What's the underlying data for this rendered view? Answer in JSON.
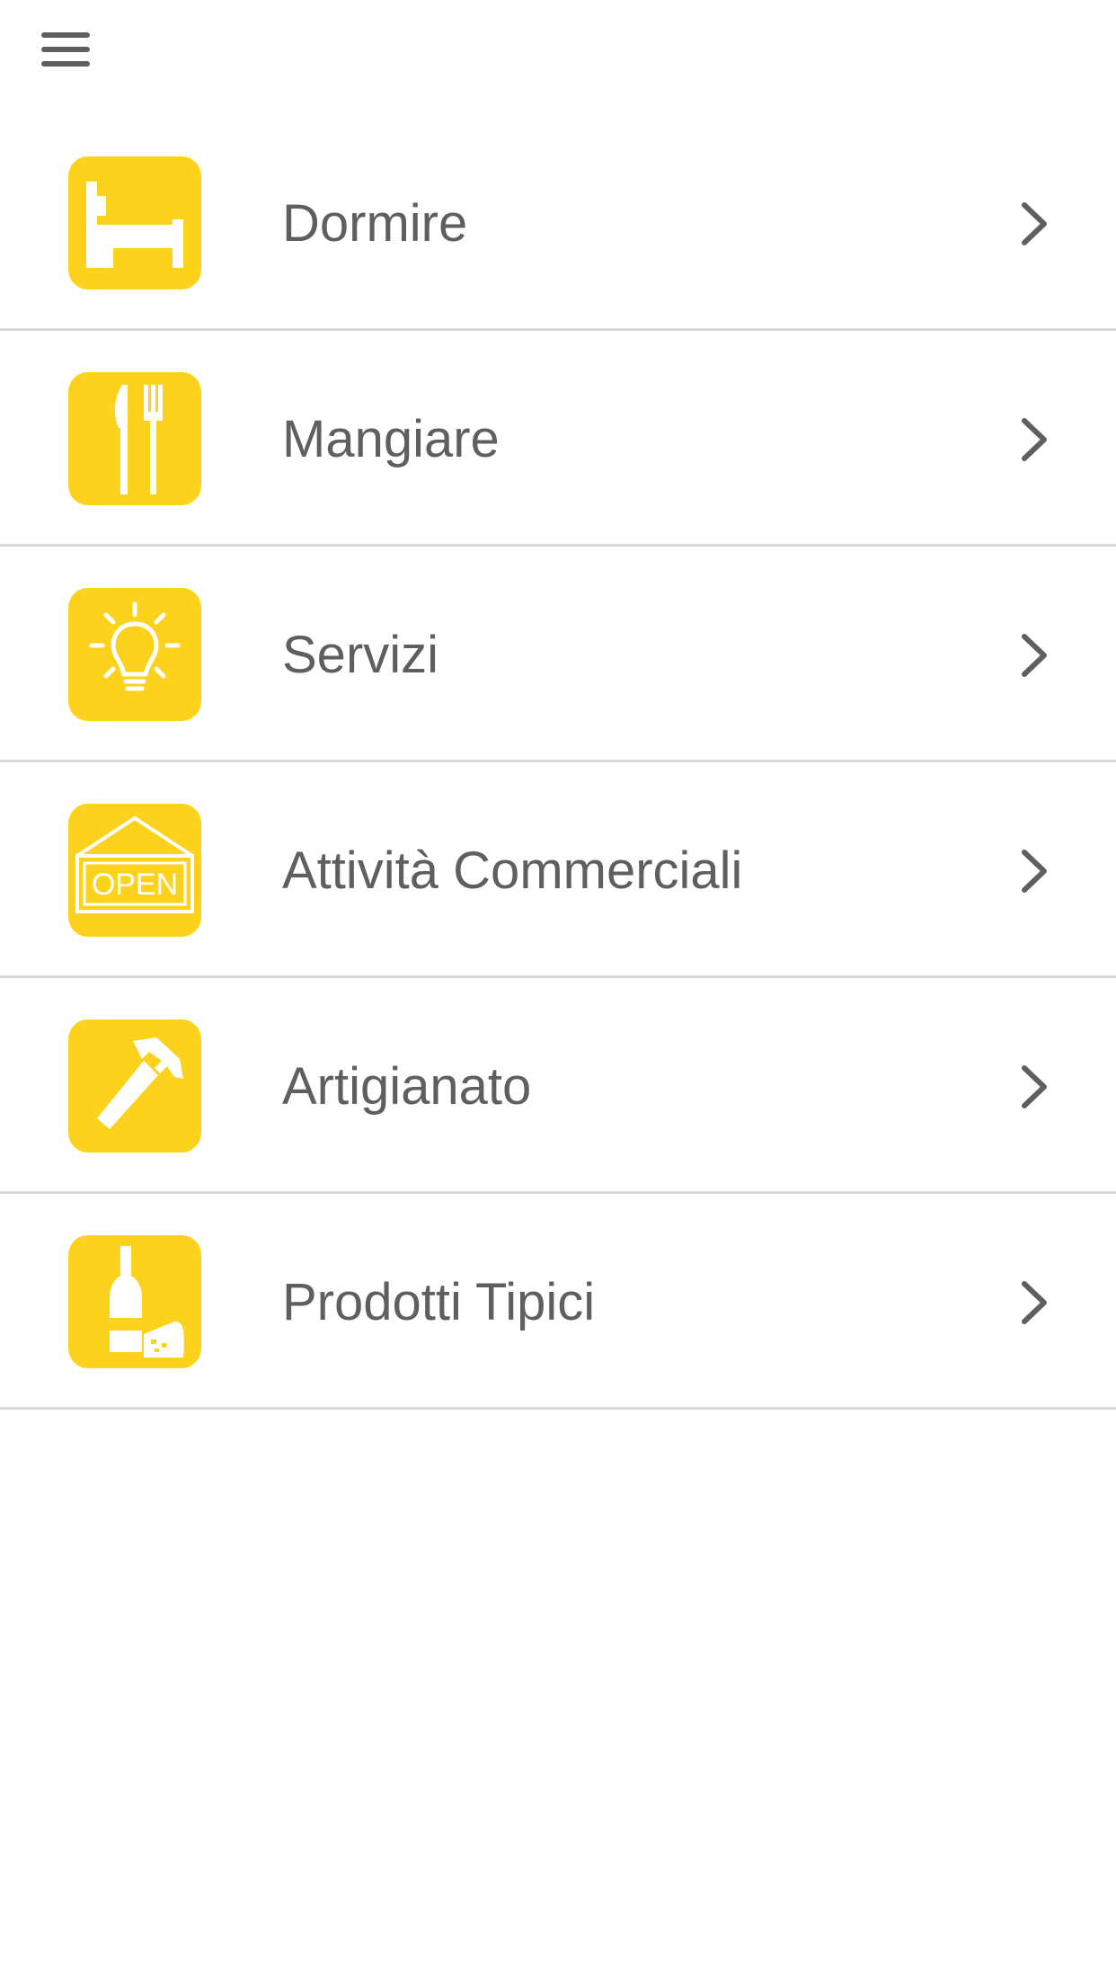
{
  "header": {
    "menu_icon": "hamburger-menu-icon"
  },
  "colors": {
    "accent": "#fcd21c",
    "text": "#5f5f5f",
    "divider": "#d9d9d9"
  },
  "menu": {
    "items": [
      {
        "label": "Dormire",
        "icon": "bed-icon"
      },
      {
        "label": "Mangiare",
        "icon": "knife-fork-icon"
      },
      {
        "label": "Servizi",
        "icon": "lightbulb-icon"
      },
      {
        "label": "Attività Commerciali",
        "icon": "open-sign-icon",
        "icon_text": "OPEN"
      },
      {
        "label": "Artigianato",
        "icon": "hammer-icon"
      },
      {
        "label": "Prodotti Tipici",
        "icon": "wine-cheese-icon"
      }
    ]
  }
}
